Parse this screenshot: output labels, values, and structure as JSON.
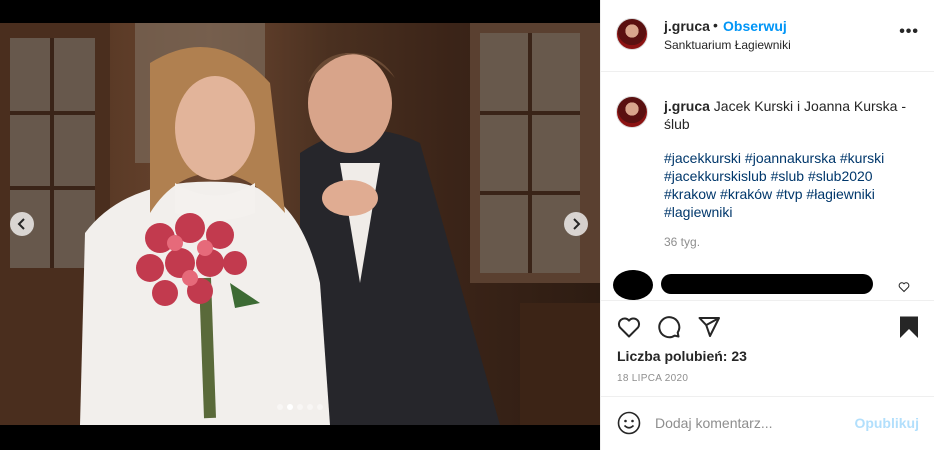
{
  "post": {
    "username": "j.gruca",
    "separator": "•",
    "follow_label": "Obserwuj",
    "location": "Sanktuarium Łagiewniki",
    "more_label": "•••"
  },
  "caption": {
    "username": "j.gruca",
    "text": "Jacek Kurski i Joanna Kurska - ślub",
    "hashtags": [
      "#jacekkurski",
      "#joannakurska",
      "#kurski",
      "#jacekkurskislub",
      "#slub",
      "#slub2020",
      "#krakow",
      "#kraków",
      "#tvp",
      "#łagiewniki",
      "#lagiewniki"
    ],
    "time_ago": "36 tyg."
  },
  "actions": {
    "likes_text": "Liczba polubień: 23",
    "date": "18 LIPCA 2020"
  },
  "comment": {
    "placeholder": "Dodaj komentarz...",
    "publish_label": "Opublikuj"
  },
  "carousel": {
    "slide_count": 5,
    "active_index": 1
  },
  "colors": {
    "accent": "#0095f6",
    "hashtag": "#00376b",
    "muted": "#8e8e8e",
    "publish_disabled": "#b2dffc"
  },
  "icons": {
    "like": "heart-icon",
    "comment": "comment-icon",
    "share": "paper-plane-icon",
    "save": "bookmark-icon",
    "emoji": "emoji-icon",
    "prev": "chevron-left-icon",
    "next": "chevron-right-icon"
  }
}
